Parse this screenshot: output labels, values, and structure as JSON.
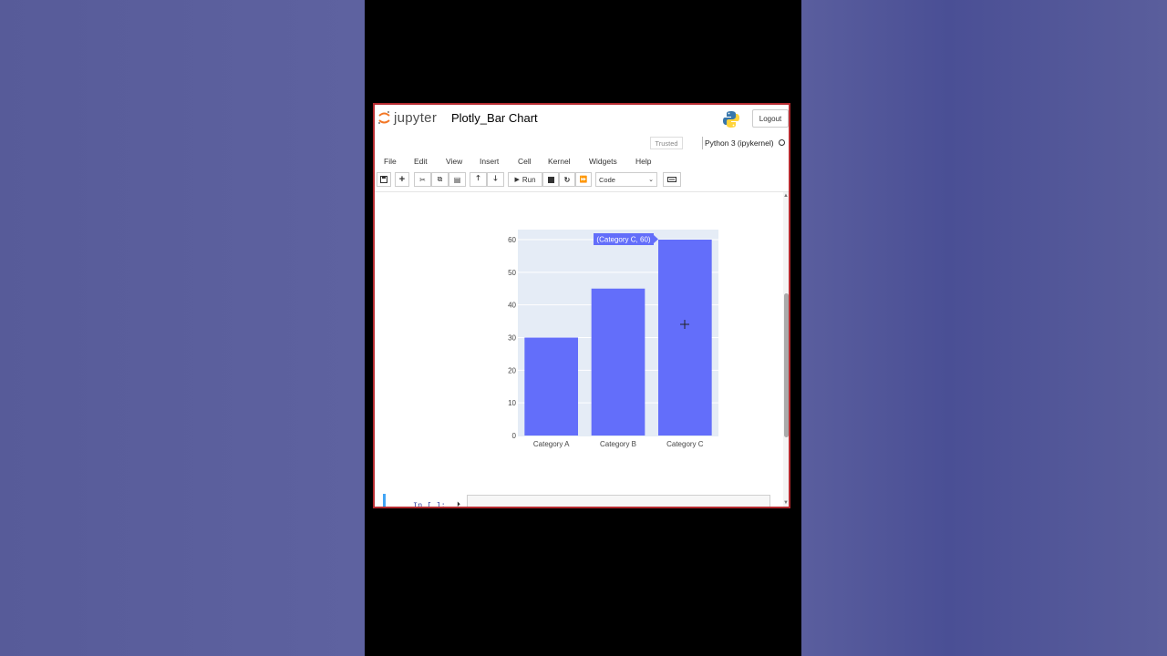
{
  "app": {
    "logo_text": "jupyter",
    "notebook_title": "Plotly_Bar Chart",
    "logout_label": "Logout",
    "trusted_label": "Trusted",
    "kernel_name": "Python 3 (ipykernel)"
  },
  "menu": [
    "File",
    "Edit",
    "View",
    "Insert",
    "Cell",
    "Kernel",
    "Widgets",
    "Help"
  ],
  "toolbar": {
    "run_label": "Run",
    "cell_type": "Code"
  },
  "next_cell": {
    "prompt": "In [ ]:"
  },
  "chart_data": {
    "type": "bar",
    "categories": [
      "Category A",
      "Category B",
      "Category C"
    ],
    "values": [
      30,
      45,
      60
    ],
    "ylim": [
      0,
      63
    ],
    "yticks": [
      0,
      10,
      20,
      30,
      40,
      50,
      60
    ],
    "bar_color": "#636efa",
    "plot_bg": "#e5ecf6",
    "hover_label": "(Category C, 60)"
  },
  "colors": {
    "frame_border": "#b52a2f",
    "accent": "#42a5f5"
  }
}
